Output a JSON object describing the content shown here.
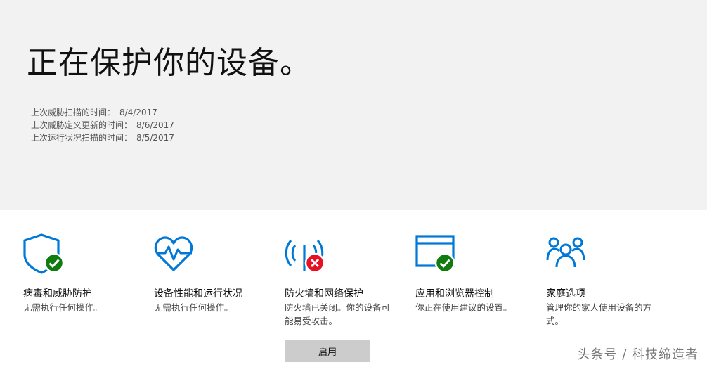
{
  "hero": {
    "title": "正在保护你的设备。",
    "scans": [
      {
        "label": "上次威胁扫描的时间：",
        "value": "8/4/2017"
      },
      {
        "label": "上次威胁定义更新的时间：",
        "value": "8/6/2017"
      },
      {
        "label": "上次运行状况扫描的时间：",
        "value": "8/5/2017"
      }
    ]
  },
  "tiles": [
    {
      "icon": "shield-check-icon",
      "title": "病毒和威胁防护",
      "desc": "无需执行任何操作。",
      "status": "ok"
    },
    {
      "icon": "heart-pulse-icon",
      "title": "设备性能和运行状况",
      "desc": "无需执行任何操作。",
      "status": "ok"
    },
    {
      "icon": "antenna-error-icon",
      "title": "防火墙和网络保护",
      "desc": "防火墙已关闭。你的设备可能易受攻击。",
      "status": "error",
      "action_label": "启用"
    },
    {
      "icon": "browser-check-icon",
      "title": "应用和浏览器控制",
      "desc": "你正在使用建议的设置。",
      "status": "ok"
    },
    {
      "icon": "family-icon",
      "title": "家庭选项",
      "desc": "管理你的家人使用设备的方式。",
      "status": "info"
    }
  ],
  "colors": {
    "accent": "#0078d7",
    "ok": "#107c10",
    "error": "#e81123",
    "hero_bg": "#f2f2f2",
    "button_bg": "#cccccc"
  },
  "watermark": "头条号 / 科技缔造者"
}
